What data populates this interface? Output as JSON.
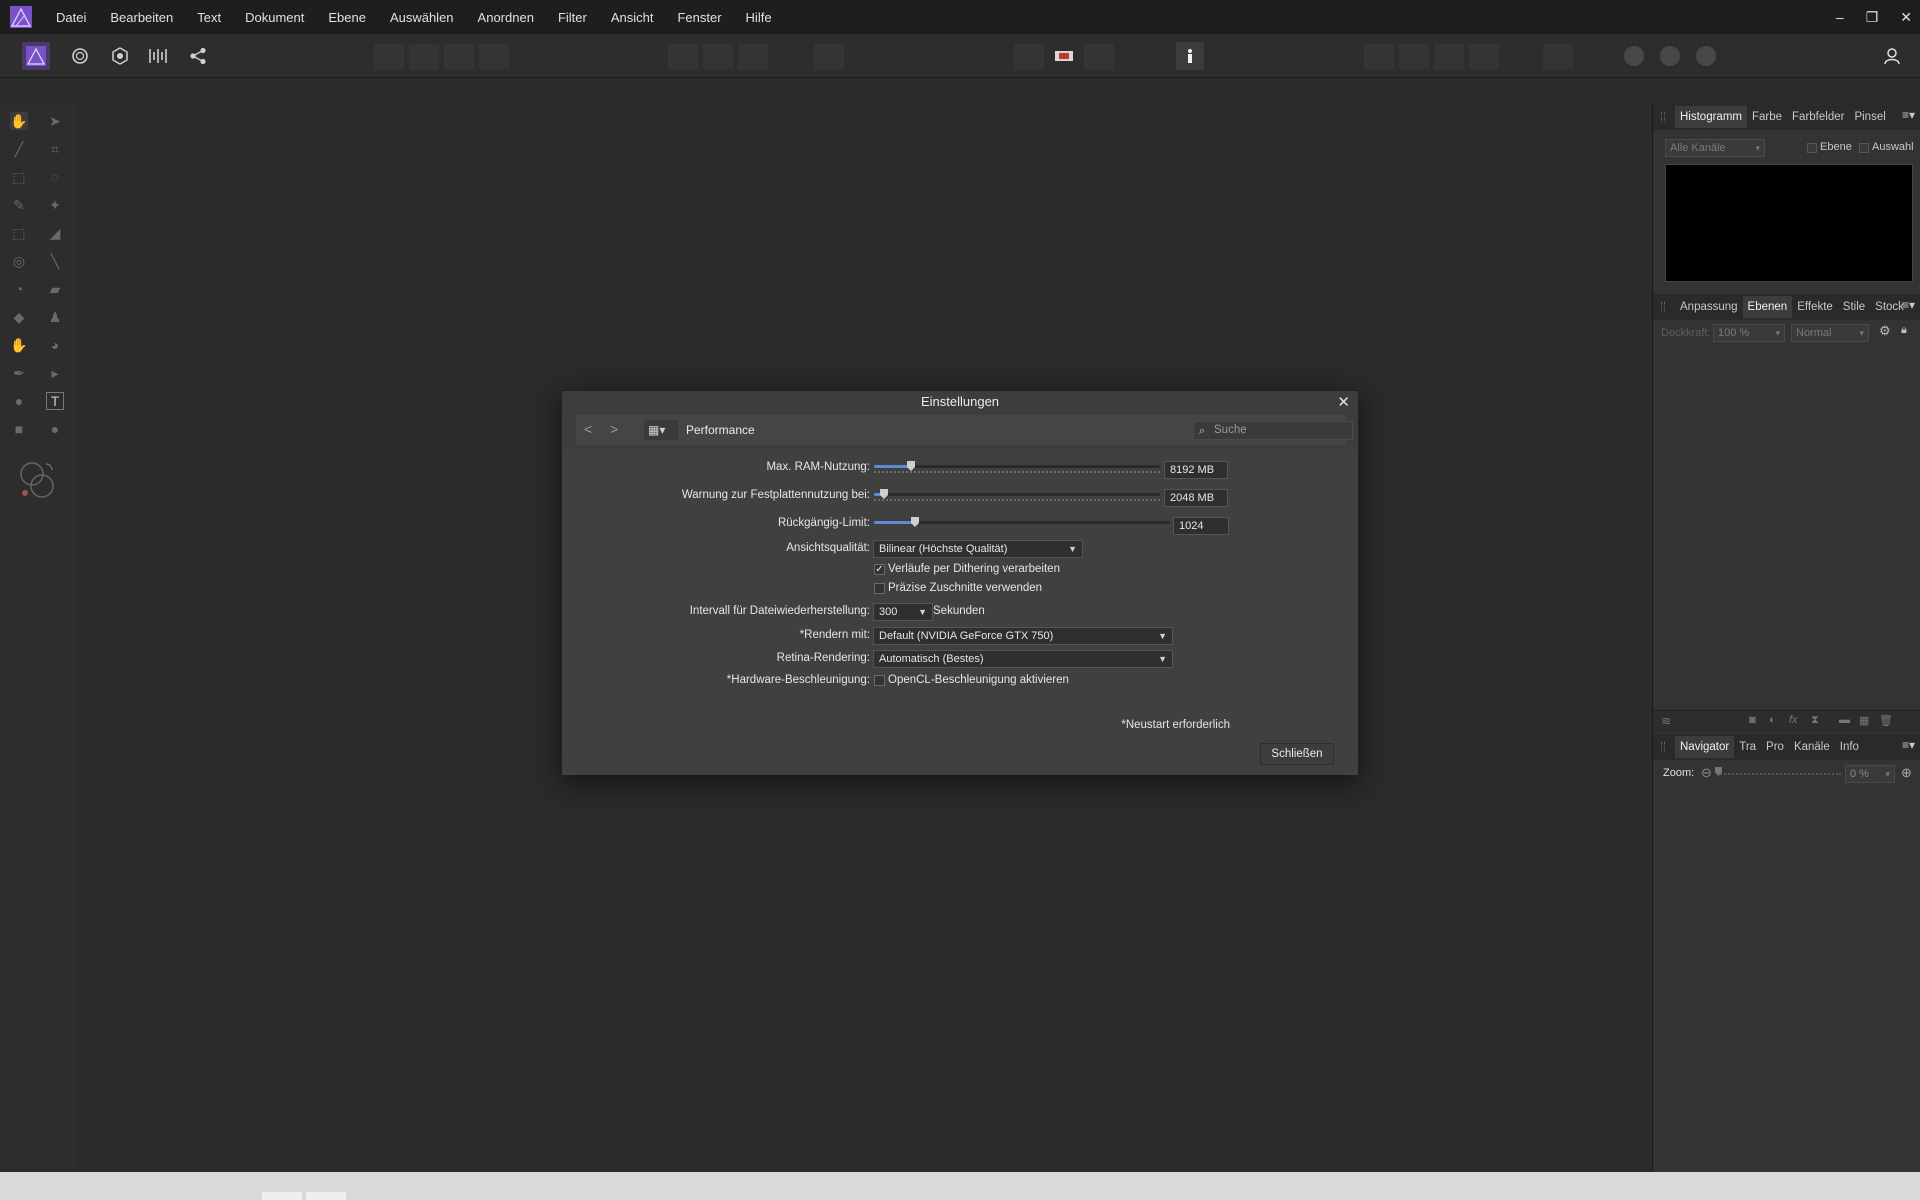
{
  "menubar": {
    "items": [
      "Datei",
      "Bearbeiten",
      "Text",
      "Dokument",
      "Ebene",
      "Auswählen",
      "Anordnen",
      "Filter",
      "Ansicht",
      "Fenster",
      "Hilfe"
    ],
    "window_controls": [
      "–",
      "❐",
      "✕"
    ]
  },
  "toolbar": {
    "persona_icons": [
      "affinity-photo-persona-icon",
      "liquify-persona-icon",
      "develop-persona-icon",
      "tone-mapping-persona-icon",
      "export-persona-icon"
    ],
    "share_glyph": "⋖",
    "user_glyph": "◯"
  },
  "right_panels": {
    "top": {
      "tabs": [
        "Histogramm",
        "Farbe",
        "Farbfelder",
        "Pinsel"
      ],
      "active": "Histogramm",
      "channel_select": "Alle Kanäle",
      "checkbox_layer": "Ebene",
      "checkbox_selection": "Auswahl"
    },
    "middle": {
      "tabs": [
        "Anpassung",
        "Ebenen",
        "Effekte",
        "Stile",
        "Stock"
      ],
      "active": "Ebenen",
      "opacity_label": "Deckkraft:",
      "opacity_value": "100 %",
      "blend_mode": "Normal"
    },
    "bottom": {
      "tabs": [
        "Navigator",
        "Tra",
        "Pro",
        "Kanäle",
        "Info"
      ],
      "active": "Navigator",
      "zoom_label": "Zoom:",
      "zoom_value": "0 %"
    }
  },
  "dialog": {
    "title": "Einstellungen",
    "close_glyph": "✕",
    "section": "Performance",
    "search_placeholder": "Suche",
    "back_glyph": "<",
    "forward_glyph": ">",
    "grid_glyph": "▦▾",
    "fields": {
      "ram_label": "Max. RAM-Nutzung:",
      "ram_value": "8192 MB",
      "ram_fraction": 0.12,
      "disk_label": "Warnung zur Festplattennutzung bei:",
      "disk_value": "2048 MB",
      "disk_fraction": 0.02,
      "undo_label": "Rückgängig-Limit:",
      "undo_value": "1024",
      "undo_fraction": 0.13,
      "view_quality_label": "Ansichtsqualität:",
      "view_quality_value": "Bilinear (Höchste Qualität)",
      "dither_label": "Verläufe per Dithering verarbeiten",
      "dither_checked": "✓",
      "precise_clip_label": "Präzise Zuschnitte verwenden",
      "recovery_label": "Intervall für Dateiwiederherstellung:",
      "recovery_value": "300",
      "recovery_unit": "Sekunden",
      "render_label": "*Rendern mit:",
      "render_value": "Default (NVIDIA GeForce GTX 750)",
      "retina_label": "Retina-Rendering:",
      "retina_value": "Automatisch (Bestes)",
      "hw_label": "*Hardware-Beschleunigung:",
      "hw_option_label": "OpenCL-Beschleunigung aktivieren"
    },
    "restart_note": "*Neustart erforderlich",
    "close_button": "Schließen"
  }
}
